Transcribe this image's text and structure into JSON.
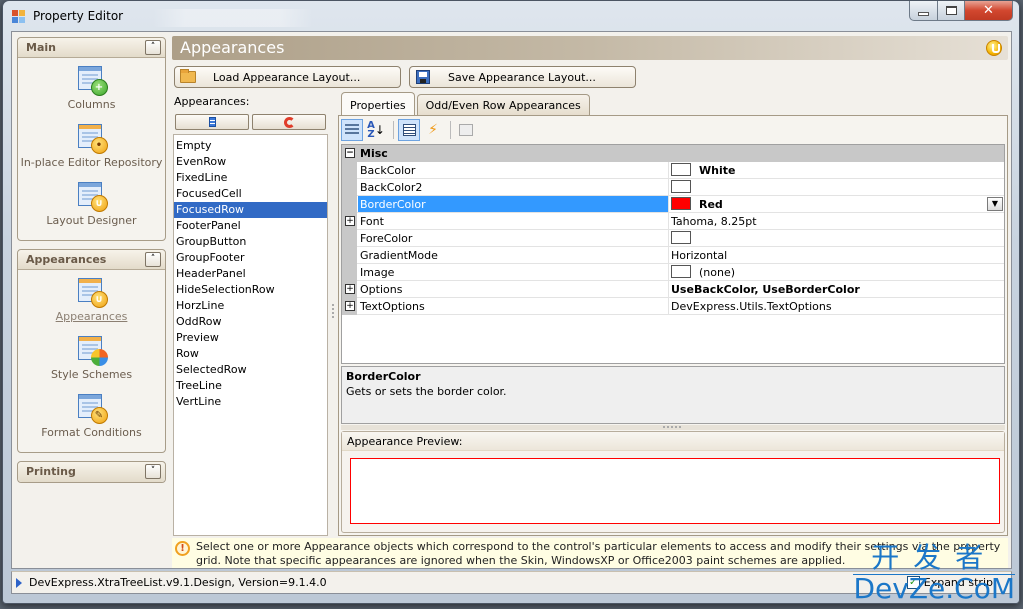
{
  "window": {
    "title": "Property Editor",
    "close_glyph": "✕"
  },
  "nav": {
    "groups": [
      {
        "title": "Main",
        "toggle": "˄",
        "items": [
          {
            "label": "Columns",
            "icon": "columns-icon"
          },
          {
            "label": "In-place Editor Repository",
            "icon": "editor-repository-icon"
          },
          {
            "label": "Layout Designer",
            "icon": "layout-designer-icon"
          }
        ]
      },
      {
        "title": "Appearances",
        "toggle": "˄",
        "items": [
          {
            "label": "Appearances",
            "icon": "appearances-icon",
            "selected": true
          },
          {
            "label": "Style Schemes",
            "icon": "style-schemes-icon"
          },
          {
            "label": "Format Conditions",
            "icon": "format-conditions-icon"
          }
        ]
      },
      {
        "title": "Printing",
        "toggle": "˅",
        "items": []
      }
    ]
  },
  "main": {
    "title": "Appearances",
    "load_button": "Load Appearance Layout...",
    "save_button": "Save Appearance Layout..."
  },
  "appearances_list": {
    "caption": "Appearances:",
    "selected": "FocusedRow",
    "items": [
      "Empty",
      "EvenRow",
      "FixedLine",
      "FocusedCell",
      "FocusedRow",
      "FooterPanel",
      "GroupButton",
      "GroupFooter",
      "HeaderPanel",
      "HideSelectionRow",
      "HorzLine",
      "OddRow",
      "Preview",
      "Row",
      "SelectedRow",
      "TreeLine",
      "VertLine"
    ]
  },
  "tabs": [
    {
      "label": "Properties",
      "active": true
    },
    {
      "label": "Odd/Even Row Appearances",
      "active": false
    }
  ],
  "property_grid": {
    "category": "Misc",
    "category_expander": "−",
    "rows": [
      {
        "name": "BackColor",
        "value": "White",
        "swatch": "#ffffff",
        "bold": true,
        "expander": ""
      },
      {
        "name": "BackColor2",
        "value": "",
        "swatch": "#ffffff",
        "bold": false,
        "expander": ""
      },
      {
        "name": "BorderColor",
        "value": "Red",
        "swatch": "#ff0000",
        "bold": true,
        "expander": "",
        "selected": true
      },
      {
        "name": "Font",
        "value": "Tahoma, 8.25pt",
        "bold": false,
        "expander": "+"
      },
      {
        "name": "ForeColor",
        "value": "",
        "swatch": "#ffffff",
        "bold": false,
        "expander": ""
      },
      {
        "name": "GradientMode",
        "value": "Horizontal",
        "bold": false,
        "expander": ""
      },
      {
        "name": "Image",
        "value": "(none)",
        "swatch": "#ffffff",
        "bold": false,
        "expander": ""
      },
      {
        "name": "Options",
        "value": "UseBackColor, UseBorderColor",
        "bold": true,
        "expander": "+"
      },
      {
        "name": "TextOptions",
        "value": "DevExpress.Utils.TextOptions",
        "bold": false,
        "expander": "+"
      }
    ],
    "dropdown_glyph": "▼"
  },
  "description": {
    "title": "BorderColor",
    "text": "Gets or sets the border color."
  },
  "preview": {
    "caption": "Appearance Preview:",
    "border_color": "#ff0000"
  },
  "hint": {
    "icon_glyph": "!",
    "text": "Select one or more Appearance objects which correspond to the control's particular elements to access and modify their settings via the property grid. Note that specific appearances are ignored when the Skin, WindowsXP or Office2003 paint schemes are applied."
  },
  "status": {
    "text": "DevExpress.XtraTreeList.v9.1.Design, Version=9.1.4.0",
    "checkbox_label": "Expand strip",
    "checkbox_checked": true,
    "check_glyph": "✓"
  },
  "watermark": {
    "top": "开发者",
    "bottom": "DevZe.CoM"
  }
}
